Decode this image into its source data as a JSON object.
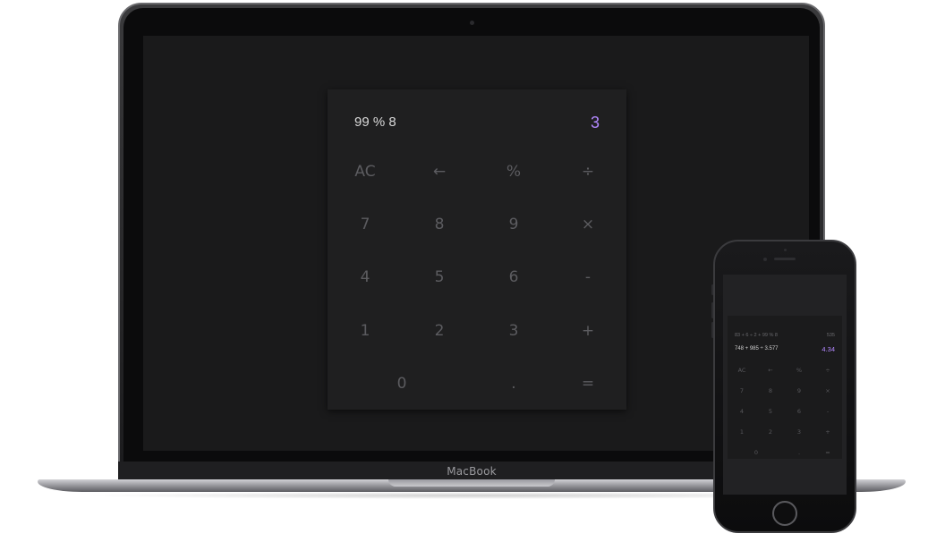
{
  "laptop": {
    "brand": "MacBook"
  },
  "calculator": {
    "expression": "99 % 8",
    "result": "3",
    "accent_color": "#b388ff",
    "keys": [
      [
        "AC",
        "←",
        "%",
        "÷"
      ],
      [
        "7",
        "8",
        "9",
        "×"
      ],
      [
        "4",
        "5",
        "6",
        "-"
      ],
      [
        "1",
        "2",
        "3",
        "+"
      ],
      [
        "0",
        ".",
        "="
      ]
    ]
  },
  "phone_calculator": {
    "history": [
      {
        "expression": "",
        "result": ""
      },
      {
        "expression": "83 + 6 ÷ 2 + 99 % 8",
        "result": "535"
      }
    ],
    "expression": "748 + 985 ÷ 3.577",
    "result": "4.34",
    "keys": [
      [
        "AC",
        "←",
        "%",
        "÷"
      ],
      [
        "7",
        "8",
        "9",
        "×"
      ],
      [
        "4",
        "5",
        "6",
        "-"
      ],
      [
        "1",
        "2",
        "3",
        "+"
      ],
      [
        "0",
        ".",
        "="
      ]
    ]
  }
}
